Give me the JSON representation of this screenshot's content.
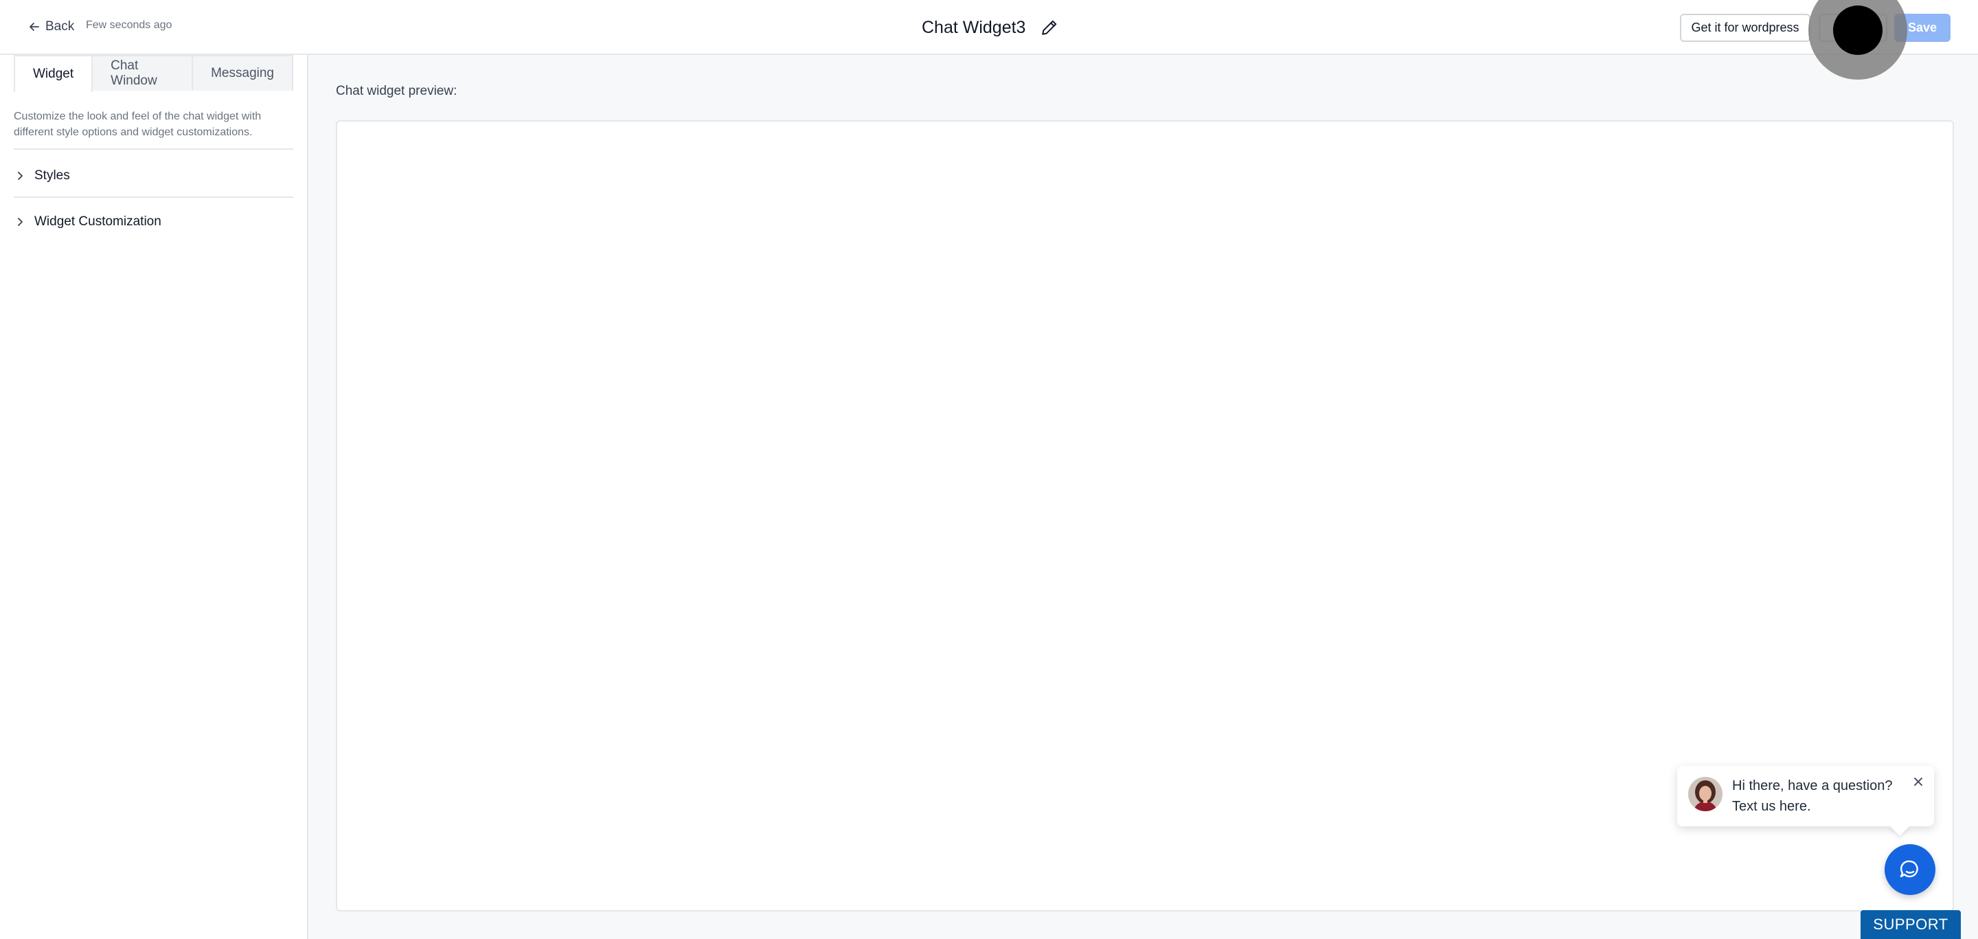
{
  "header": {
    "back_label": "Back",
    "saved_time": "Few seconds ago",
    "title": "Chat Widget3",
    "wordpress_button": "Get it for wordpress",
    "save_button": "Save",
    "save_color": "#8fb6f6"
  },
  "sidebar": {
    "tabs": [
      {
        "label": "Widget",
        "active": true
      },
      {
        "label": "Chat Window",
        "active": false
      },
      {
        "label": "Messaging",
        "active": false
      }
    ],
    "description": "Customize the look and feel of the chat widget with different style options and widget customizations.",
    "sections": [
      {
        "label": "Styles",
        "icon": "chevron-right-icon"
      },
      {
        "label": "Widget Customization",
        "icon": "chevron-right-icon"
      }
    ]
  },
  "main": {
    "preview_label": "Chat widget preview:",
    "widget": {
      "greeting": "Hi there, have a question? Text us here.",
      "accent_color": "#1565e0"
    },
    "support_button": "SUPPORT"
  }
}
